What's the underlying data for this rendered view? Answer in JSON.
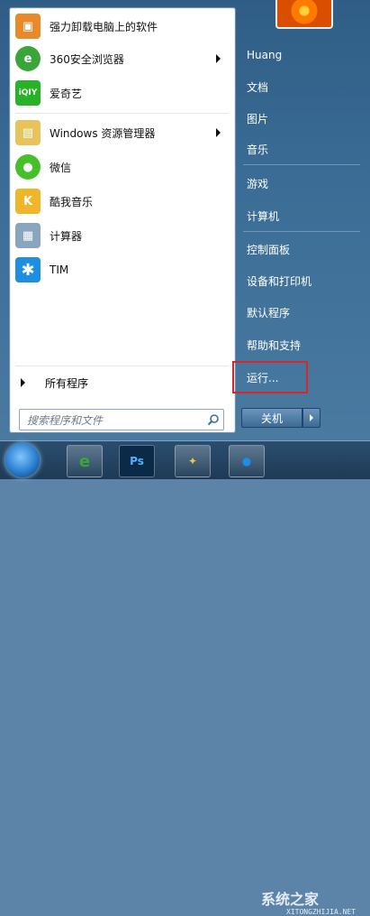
{
  "left_pane": {
    "pinned": [
      {
        "label": "强力卸载电脑上的软件",
        "icon": "uninstall-box-icon"
      },
      {
        "label": "360安全浏览器",
        "icon": "browser-360-icon",
        "has_submenu": true
      },
      {
        "label": "爱奇艺",
        "icon": "iqiyi-icon"
      }
    ],
    "recent": [
      {
        "label": "Windows 资源管理器",
        "icon": "folder-explorer-icon",
        "has_submenu": true
      },
      {
        "label": "微信",
        "icon": "wechat-icon"
      },
      {
        "label": "酷我音乐",
        "icon": "kuwo-music-icon"
      },
      {
        "label": "计算器",
        "icon": "calculator-icon"
      },
      {
        "label": "TIM",
        "icon": "tim-icon"
      }
    ],
    "all_programs": "所有程序",
    "search_placeholder": "搜索程序和文件"
  },
  "right_pane": {
    "links": [
      "Huang",
      "文档",
      "图片",
      "音乐",
      "游戏",
      "计算机",
      "控制面板",
      "设备和打印机",
      "默认程序",
      "帮助和支持",
      "运行..."
    ],
    "highlighted": "运行...",
    "shutdown_label": "关机"
  },
  "taskbar": {
    "watermark": "系统之家",
    "watermark_sub": "XITONGZHIJIA.NET"
  },
  "colors": {
    "highlight_box": "#d9262c",
    "menu_accent": "#2f5d85"
  }
}
